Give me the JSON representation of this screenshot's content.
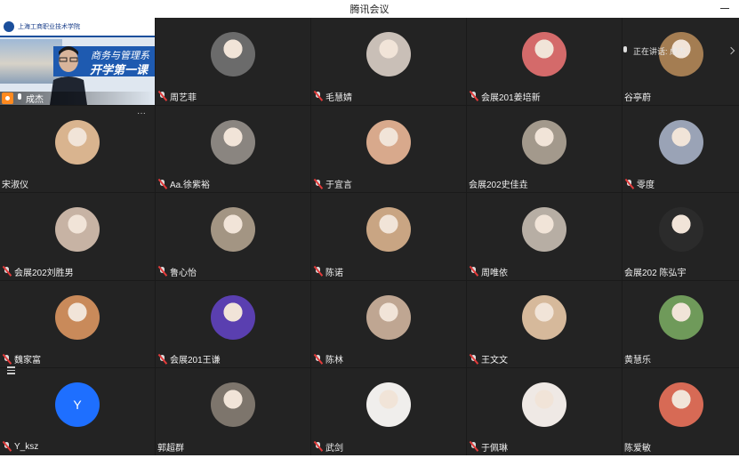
{
  "window": {
    "title": "腾讯会议"
  },
  "speaking_indicator": "正在讲话: 成杰",
  "speaker": {
    "name": "成杰",
    "slide_school": "上海工商职业技术学院",
    "slide_line1": "商务与管理系",
    "slide_line2": "开学第一课"
  },
  "participants": [
    {
      "name": "周艺菲",
      "muted": true,
      "color": "#6b6b6b"
    },
    {
      "name": "毛慧婧",
      "muted": true,
      "color": "#c9bfb7"
    },
    {
      "name": "会展201姜培新",
      "muted": true,
      "color": "#d46a6a"
    },
    {
      "name": "谷亭蔚",
      "muted": false,
      "color": "#a47d52"
    },
    {
      "name": "宋淑仪",
      "muted": false,
      "color": "#d9b48f"
    },
    {
      "name": "Aa.徐紫裕",
      "muted": true,
      "color": "#8a8580"
    },
    {
      "name": "于宜言",
      "muted": true,
      "color": "#d8a98c"
    },
    {
      "name": "会展202史佳垚",
      "muted": false,
      "color": "#a3998c"
    },
    {
      "name": "零度",
      "muted": true,
      "color": "#9aa3b6"
    },
    {
      "name": "会展202刘胜男",
      "muted": true,
      "color": "#c7b3a4"
    },
    {
      "name": "鲁心怡",
      "muted": true,
      "color": "#a39583"
    },
    {
      "name": "陈诺",
      "muted": true,
      "color": "#c9a583"
    },
    {
      "name": "周唯依",
      "muted": true,
      "color": "#b7aea4"
    },
    {
      "name": "会展202 陈弘宇",
      "muted": false,
      "color": "#2b2b2b"
    },
    {
      "name": "魏家富",
      "muted": true,
      "color": "#c98a5a"
    },
    {
      "name": "会展201王谦",
      "muted": true,
      "color": "#5a3fb0"
    },
    {
      "name": "陈林",
      "muted": true,
      "color": "#bfa692"
    },
    {
      "name": "王文文",
      "muted": true,
      "color": "#d6b99b"
    },
    {
      "name": "黄慧乐",
      "muted": false,
      "color": "#6f9a5a"
    },
    {
      "name": "Y_ksz",
      "muted": true,
      "letter": "Y",
      "color": "#1e6fff"
    },
    {
      "name": "郭超群",
      "muted": false,
      "color": "#7d756c"
    },
    {
      "name": "武剑",
      "muted": true,
      "color": "#f0eeec"
    },
    {
      "name": "于佩琳",
      "muted": true,
      "color": "#efe9e5"
    },
    {
      "name": "陈爱敏",
      "muted": false,
      "color": "#d76a55"
    }
  ]
}
